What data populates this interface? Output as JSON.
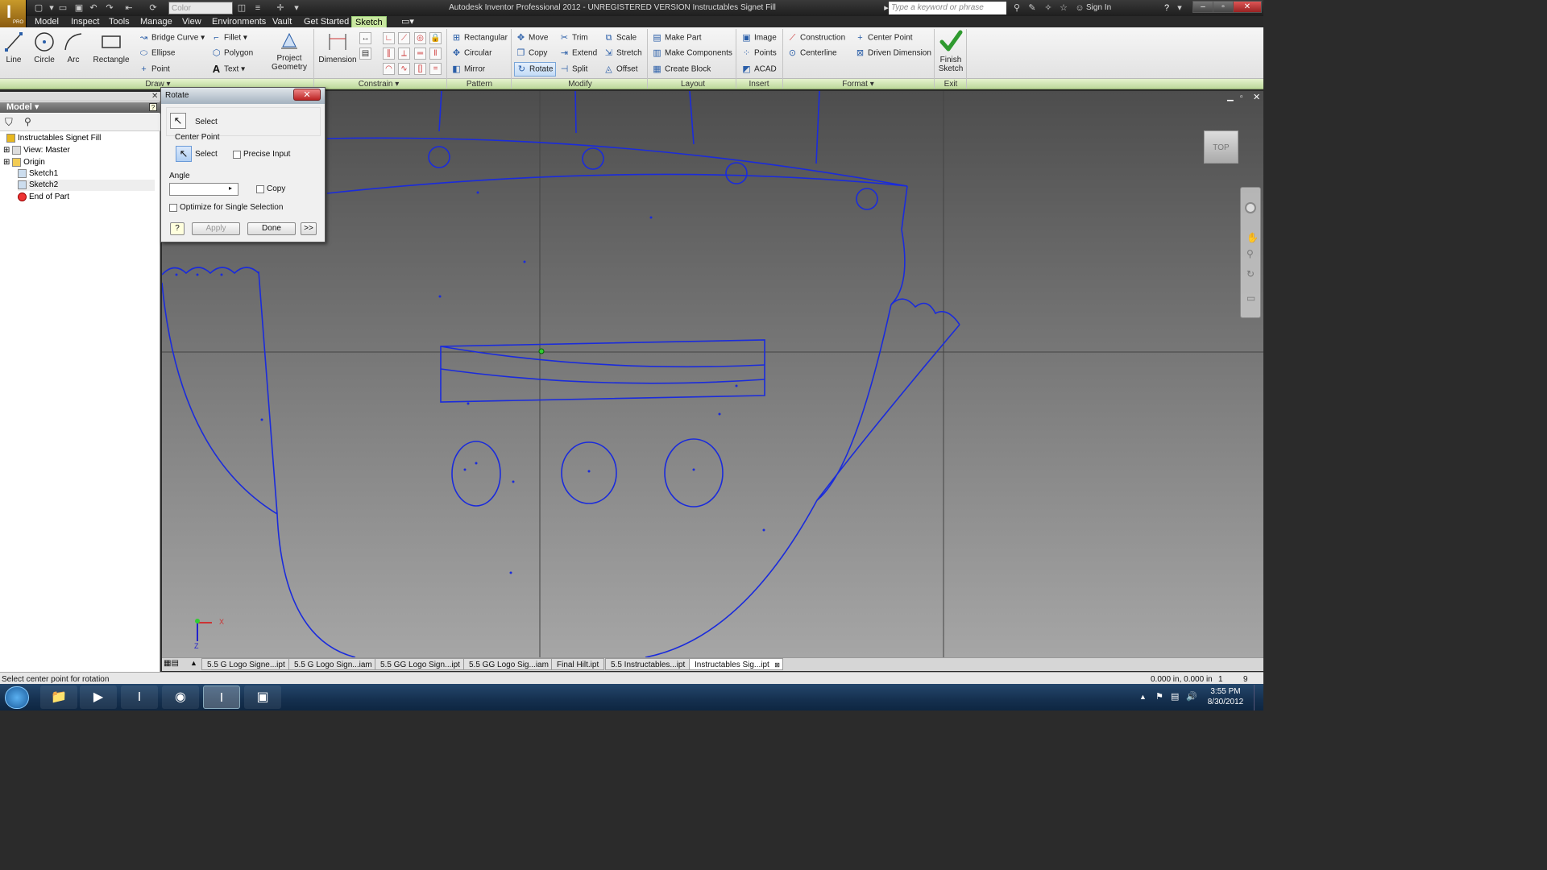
{
  "window": {
    "title": "Autodesk Inventor Professional 2012 - UNREGISTERED VERSION   Instructables Signet Fill"
  },
  "app_button": {
    "letter": "I",
    "badge": "PRO"
  },
  "quick_access": {
    "color_placeholder": "Color"
  },
  "help": {
    "search_placeholder": "Type a keyword or phrase",
    "sign_in": "Sign In"
  },
  "menu_tabs": [
    "Model",
    "Inspect",
    "Tools",
    "Manage",
    "View",
    "Environments",
    "Vault",
    "Get Started",
    "Sketch"
  ],
  "active_tab": "Sketch",
  "ribbon": {
    "draw": {
      "line": "Line",
      "circle": "Circle",
      "arc": "Arc",
      "rectangle": "Rectangle",
      "bridge_curve": "Bridge Curve",
      "ellipse": "Ellipse",
      "point": "Point",
      "fillet": "Fillet",
      "polygon": "Polygon",
      "text": "Text",
      "project_geometry_1": "Project",
      "project_geometry_2": "Geometry",
      "label": "Draw"
    },
    "constrain": {
      "dimension": "Dimension",
      "label": "Constrain"
    },
    "pattern": {
      "rectangular": "Rectangular",
      "circular": "Circular",
      "mirror": "Mirror",
      "label": "Pattern"
    },
    "modify": {
      "move": "Move",
      "copy": "Copy",
      "rotate": "Rotate",
      "trim": "Trim",
      "extend": "Extend",
      "split": "Split",
      "scale": "Scale",
      "stretch": "Stretch",
      "offset": "Offset",
      "label": "Modify"
    },
    "layout": {
      "make_part": "Make Part",
      "make_components": "Make Components",
      "create_block": "Create Block",
      "label": "Layout"
    },
    "insert": {
      "image": "Image",
      "points": "Points",
      "acad": "ACAD",
      "label": "Insert"
    },
    "format": {
      "construction": "Construction",
      "centerline": "Centerline",
      "center_point": "Center Point",
      "driven_dimension": "Driven Dimension",
      "label": "Format"
    },
    "exit": {
      "finish_1": "Finish",
      "finish_2": "Sketch",
      "label": "Exit"
    }
  },
  "browser": {
    "header": "Model",
    "items": [
      {
        "label": "Instructables Signet Fill"
      },
      {
        "label": "View: Master"
      },
      {
        "label": "Origin"
      },
      {
        "label": "Sketch1"
      },
      {
        "label": "Sketch2"
      },
      {
        "label": "End of Part"
      }
    ]
  },
  "dialog": {
    "title": "Rotate",
    "select_label": "Select",
    "center_point_label": "Center Point",
    "center_select_label": "Select",
    "precise_input_label": "Precise Input",
    "angle_label": "Angle",
    "angle_value": "",
    "copy_label": "Copy",
    "optimize_label": "Optimize for Single Selection",
    "apply_label": "Apply",
    "done_label": "Done",
    "more_label": ">>",
    "help_label": "?"
  },
  "viewcube": {
    "label": "TOP"
  },
  "doc_tabs": [
    {
      "label": "5.5 G Logo Signe...ipt"
    },
    {
      "label": "5.5 G Logo Sign...iam"
    },
    {
      "label": "5.5 GG Logo Sign...ipt"
    },
    {
      "label": "5.5 GG Logo Sig...iam"
    },
    {
      "label": "Final Hilt.ipt"
    },
    {
      "label": "5.5 Instructables...ipt"
    },
    {
      "label": "Instructables Sig...ipt"
    }
  ],
  "status": {
    "message": "Select center point for rotation",
    "coords": "0.000 in, 0.000 in",
    "count1": "1",
    "count2": "9"
  },
  "taskbar": {
    "time": "3:55 PM",
    "date": "8/30/2012"
  },
  "colors": {
    "sketch_line": "#1a2bdc",
    "ribbon_active": "#c9e7a0",
    "panel_bar": "#bcd89a"
  }
}
